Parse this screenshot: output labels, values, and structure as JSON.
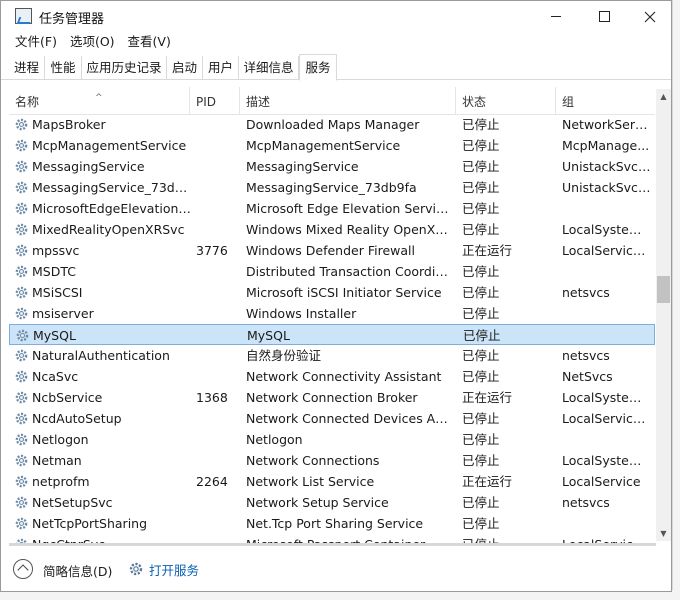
{
  "window": {
    "title": "任务管理器"
  },
  "menu": [
    "文件(F)",
    "选项(O)",
    "查看(V)"
  ],
  "tabs": [
    {
      "label": "进程",
      "active": false
    },
    {
      "label": "性能",
      "active": false
    },
    {
      "label": "应用历史记录",
      "active": false
    },
    {
      "label": "启动",
      "active": false
    },
    {
      "label": "用户",
      "active": false
    },
    {
      "label": "详细信息",
      "active": false
    },
    {
      "label": "服务",
      "active": true
    }
  ],
  "columns": {
    "name": "名称",
    "pid": "PID",
    "desc": "描述",
    "status": "状态",
    "group": "组"
  },
  "rows": [
    {
      "name": "MapsBroker",
      "pid": "",
      "desc": "Downloaded Maps Manager",
      "status": "已停止",
      "group": "NetworkServ..."
    },
    {
      "name": "McpManagementService",
      "pid": "",
      "desc": "McpManagementService",
      "status": "已停止",
      "group": "McpManage..."
    },
    {
      "name": "MessagingService",
      "pid": "",
      "desc": "MessagingService",
      "status": "已停止",
      "group": "UnistackSvcG..."
    },
    {
      "name": "MessagingService_73db...",
      "pid": "",
      "desc": "MessagingService_73db9fa",
      "status": "已停止",
      "group": "UnistackSvcG..."
    },
    {
      "name": "MicrosoftEdgeElevationS...",
      "pid": "",
      "desc": "Microsoft Edge Elevation Service...",
      "status": "已停止",
      "group": ""
    },
    {
      "name": "MixedRealityOpenXRSvc",
      "pid": "",
      "desc": "Windows Mixed Reality OpenXR ...",
      "status": "已停止",
      "group": "LocalSystem..."
    },
    {
      "name": "mpssvc",
      "pid": "3776",
      "desc": "Windows Defender Firewall",
      "status": "正在运行",
      "group": "LocalService..."
    },
    {
      "name": "MSDTC",
      "pid": "",
      "desc": "Distributed Transaction Coordina...",
      "status": "已停止",
      "group": ""
    },
    {
      "name": "MSiSCSI",
      "pid": "",
      "desc": "Microsoft iSCSI Initiator Service",
      "status": "已停止",
      "group": "netsvcs"
    },
    {
      "name": "msiserver",
      "pid": "",
      "desc": "Windows Installer",
      "status": "已停止",
      "group": ""
    },
    {
      "name": "MySQL",
      "pid": "",
      "desc": "MySQL",
      "status": "已停止",
      "group": "",
      "selected": true
    },
    {
      "name": "NaturalAuthentication",
      "pid": "",
      "desc": "自然身份验证",
      "status": "已停止",
      "group": "netsvcs"
    },
    {
      "name": "NcaSvc",
      "pid": "",
      "desc": "Network Connectivity Assistant",
      "status": "已停止",
      "group": "NetSvcs"
    },
    {
      "name": "NcbService",
      "pid": "1368",
      "desc": "Network Connection Broker",
      "status": "正在运行",
      "group": "LocalSystem..."
    },
    {
      "name": "NcdAutoSetup",
      "pid": "",
      "desc": "Network Connected Devices Aut...",
      "status": "已停止",
      "group": "LocalService..."
    },
    {
      "name": "Netlogon",
      "pid": "",
      "desc": "Netlogon",
      "status": "已停止",
      "group": ""
    },
    {
      "name": "Netman",
      "pid": "",
      "desc": "Network Connections",
      "status": "已停止",
      "group": "LocalSystem..."
    },
    {
      "name": "netprofm",
      "pid": "2264",
      "desc": "Network List Service",
      "status": "正在运行",
      "group": "LocalService"
    },
    {
      "name": "NetSetupSvc",
      "pid": "",
      "desc": "Network Setup Service",
      "status": "已停止",
      "group": "netsvcs"
    },
    {
      "name": "NetTcpPortSharing",
      "pid": "",
      "desc": "Net.Tcp Port Sharing Service",
      "status": "已停止",
      "group": ""
    },
    {
      "name": "NgcCtnrSvc",
      "pid": "",
      "desc": "Microsoft Passport Container",
      "status": "已停止",
      "group": "LocalService..."
    }
  ],
  "footer": {
    "brief": "简略信息(D)",
    "open_services": "打开服务"
  },
  "colors": {
    "selected_bg": "#cce4f7",
    "selected_border": "#80aedb",
    "link": "#0a5fb4"
  }
}
